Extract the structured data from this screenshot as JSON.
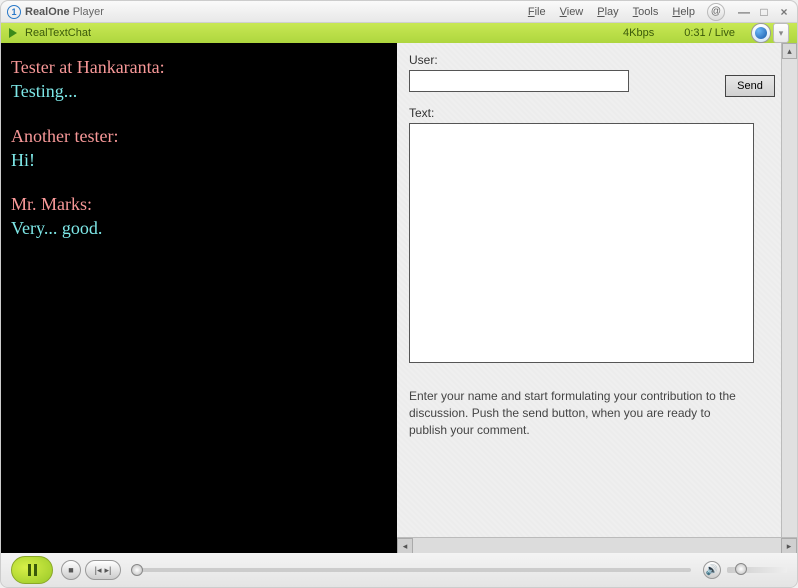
{
  "app": {
    "title_bold": "RealOne",
    "title_rest": " Player"
  },
  "menu": {
    "file": "File",
    "view": "View",
    "play": "Play",
    "tools": "Tools",
    "help": "Help"
  },
  "status": {
    "title": "RealTextChat",
    "rate": "4Kbps",
    "time": "0:31 / Live"
  },
  "chat": {
    "messages": [
      {
        "user": "Tester at Hankaranta:",
        "text": "Testing..."
      },
      {
        "user": "Another tester:",
        "text": "Hi!"
      },
      {
        "user": "Mr. Marks:",
        "text": "Very... good."
      }
    ]
  },
  "form": {
    "user_label": "User:",
    "text_label": "Text:",
    "send_label": "Send",
    "user_value": "",
    "text_value": "",
    "instructions": "Enter your name and start formulating your contribution to the discussion. Push the send button, when you are ready to publish your comment."
  },
  "icons": {
    "logo_glyph": "1",
    "at_glyph": "@",
    "minimize": "—",
    "maximize": "□",
    "close": "×",
    "dropdown": "▾",
    "up": "▴",
    "down": "▾",
    "left": "◂",
    "right": "▸",
    "stop": "■",
    "prev": "|◂",
    "next": "▸|",
    "speaker": "🔊"
  }
}
